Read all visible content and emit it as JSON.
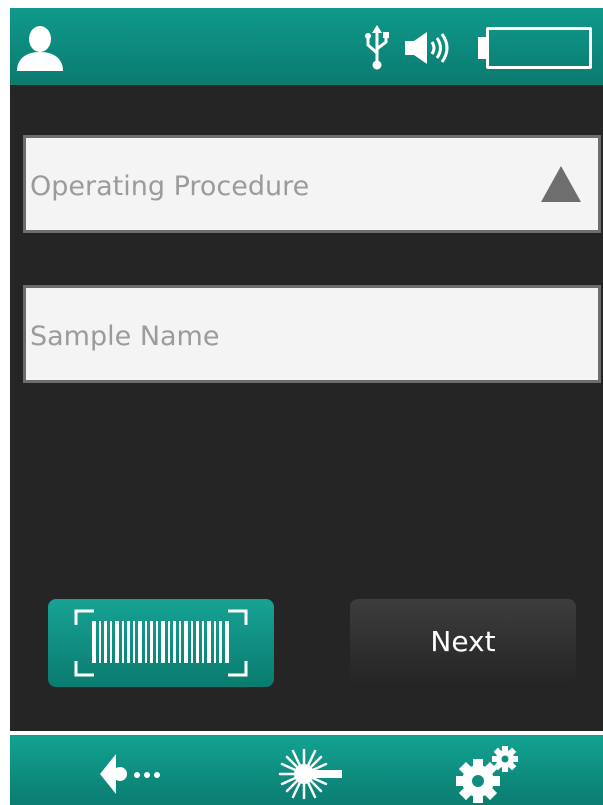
{
  "topbar": {
    "user_icon": "user-icon",
    "status_icons": [
      "usb-icon",
      "speaker-icon",
      "battery-icon"
    ]
  },
  "form": {
    "operating_procedure": {
      "placeholder": "Operating Procedure",
      "icon": "triangle-up-icon"
    },
    "sample_name": {
      "placeholder": "Sample Name"
    }
  },
  "buttons": {
    "scan_icon": "barcode-icon",
    "next_label": "Next"
  },
  "bottombar": {
    "items": [
      "back-icon",
      "laser-icon",
      "settings-icon"
    ]
  }
}
